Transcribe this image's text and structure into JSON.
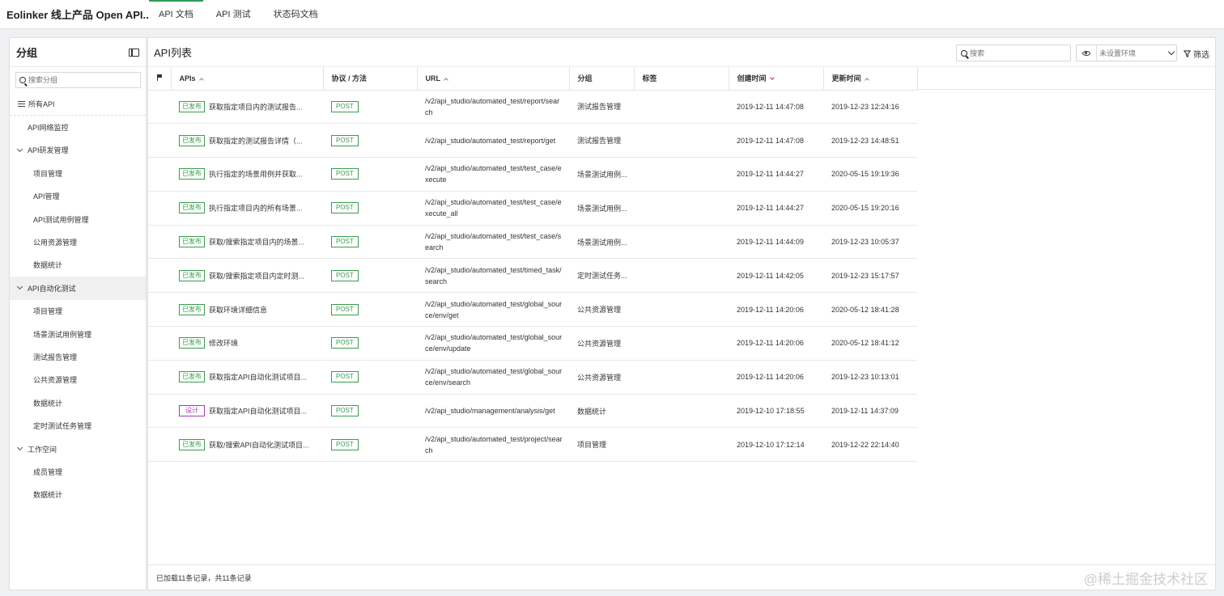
{
  "app": {
    "title": "Eolinker 线上产品 Open API..."
  },
  "top_tabs": [
    {
      "label": "API 文档",
      "active": true
    },
    {
      "label": "API 测试",
      "active": false
    },
    {
      "label": "状态码文档",
      "active": false
    }
  ],
  "sidebar": {
    "title": "分组",
    "search_placeholder": "搜索分组",
    "all_label": "所有API",
    "items": [
      {
        "label": "API网络监控"
      },
      {
        "label": "API研发管理"
      },
      {
        "label": "项目管理"
      },
      {
        "label": "API管理"
      },
      {
        "label": "API测试用例管理"
      },
      {
        "label": "公用资源管理"
      },
      {
        "label": "数据统计"
      },
      {
        "label": "API自动化测试"
      },
      {
        "label": "项目管理"
      },
      {
        "label": "场景测试用例管理"
      },
      {
        "label": "测试报告管理"
      },
      {
        "label": "公共资源管理"
      },
      {
        "label": "数据统计"
      },
      {
        "label": "定时测试任务管理"
      },
      {
        "label": "工作空间"
      },
      {
        "label": "成员管理"
      },
      {
        "label": "数据统计"
      }
    ]
  },
  "main": {
    "title": "API列表",
    "search_placeholder": "搜索",
    "env_placeholder": "未设置环境",
    "filter_label": "筛选",
    "columns": {
      "apis": "APIs",
      "method": "协议 / 方法",
      "url": "URL",
      "group": "分组",
      "tag": "标签",
      "created": "创建时间",
      "updated": "更新时间"
    },
    "rows": [
      {
        "status": "已发布",
        "name": "获取指定项目内的测试报告...",
        "method": "POST",
        "url": "/v2/api_studio/automated_test/report/search",
        "group": "测试报告管理",
        "tag": "",
        "created": "2019-12-11 14:47:08",
        "updated": "2019-12-23 12:24:16"
      },
      {
        "status": "已发布",
        "name": "获取指定的测试报告详情（...",
        "method": "POST",
        "url": "/v2/api_studio/automated_test/report/get",
        "group": "测试报告管理",
        "tag": "",
        "created": "2019-12-11 14:47:08",
        "updated": "2019-12-23 14:48:51"
      },
      {
        "status": "已发布",
        "name": "执行指定的场景用例并获取...",
        "method": "POST",
        "url": "/v2/api_studio/automated_test/test_case/execute",
        "group": "场景测试用例...",
        "tag": "",
        "created": "2019-12-11 14:44:27",
        "updated": "2020-05-15 19:19:36"
      },
      {
        "status": "已发布",
        "name": "执行指定项目内的所有场景...",
        "method": "POST",
        "url": "/v2/api_studio/automated_test/test_case/execute_all",
        "group": "场景测试用例...",
        "tag": "",
        "created": "2019-12-11 14:44:27",
        "updated": "2020-05-15 19:20:16"
      },
      {
        "status": "已发布",
        "name": "获取/搜索指定项目内的场景...",
        "method": "POST",
        "url": "/v2/api_studio/automated_test/test_case/search",
        "group": "场景测试用例...",
        "tag": "",
        "created": "2019-12-11 14:44:09",
        "updated": "2019-12-23 10:05:37"
      },
      {
        "status": "已发布",
        "name": "获取/搜索指定项目内定时测...",
        "method": "POST",
        "url": "/v2/api_studio/automated_test/timed_task/search",
        "group": "定时测试任务...",
        "tag": "",
        "created": "2019-12-11 14:42:05",
        "updated": "2019-12-23 15:17:57"
      },
      {
        "status": "已发布",
        "name": "获取环境详细信息",
        "method": "POST",
        "url": "/v2/api_studio/automated_test/global_source/env/get",
        "group": "公共资源管理",
        "tag": "",
        "created": "2019-12-11 14:20:06",
        "updated": "2020-05-12 18:41:28"
      },
      {
        "status": "已发布",
        "name": "修改环境",
        "method": "POST",
        "url": "/v2/api_studio/automated_test/global_source/env/update",
        "group": "公共资源管理",
        "tag": "",
        "created": "2019-12-11 14:20:06",
        "updated": "2020-05-12 18:41:12"
      },
      {
        "status": "已发布",
        "name": "获取指定API自动化测试项目...",
        "method": "POST",
        "url": "/v2/api_studio/automated_test/global_source/env/search",
        "group": "公共资源管理",
        "tag": "",
        "created": "2019-12-11 14:20:06",
        "updated": "2019-12-23 10:13:01"
      },
      {
        "status": "设计",
        "name": "获取指定API自动化测试项目...",
        "method": "POST",
        "url": "/v2/api_studio/management/analysis/get",
        "group": "数据统计",
        "tag": "",
        "created": "2019-12-10 17:18:55",
        "updated": "2019-12-11 14:37:09"
      },
      {
        "status": "已发布",
        "name": "获取/搜索API自动化测试项目...",
        "method": "POST",
        "url": "/v2/api_studio/automated_test/project/search",
        "group": "项目管理",
        "tag": "",
        "created": "2019-12-10 17:12:14",
        "updated": "2019-12-22 22:14:40"
      }
    ],
    "footer": "已加载11条记录，共11条记录"
  },
  "watermark": "@稀土掘金技术社区",
  "colors": {
    "accent": "#2e9b58",
    "published": "#3a9c4e",
    "design": "#a23bb0",
    "sort_active": "#d8262e"
  }
}
